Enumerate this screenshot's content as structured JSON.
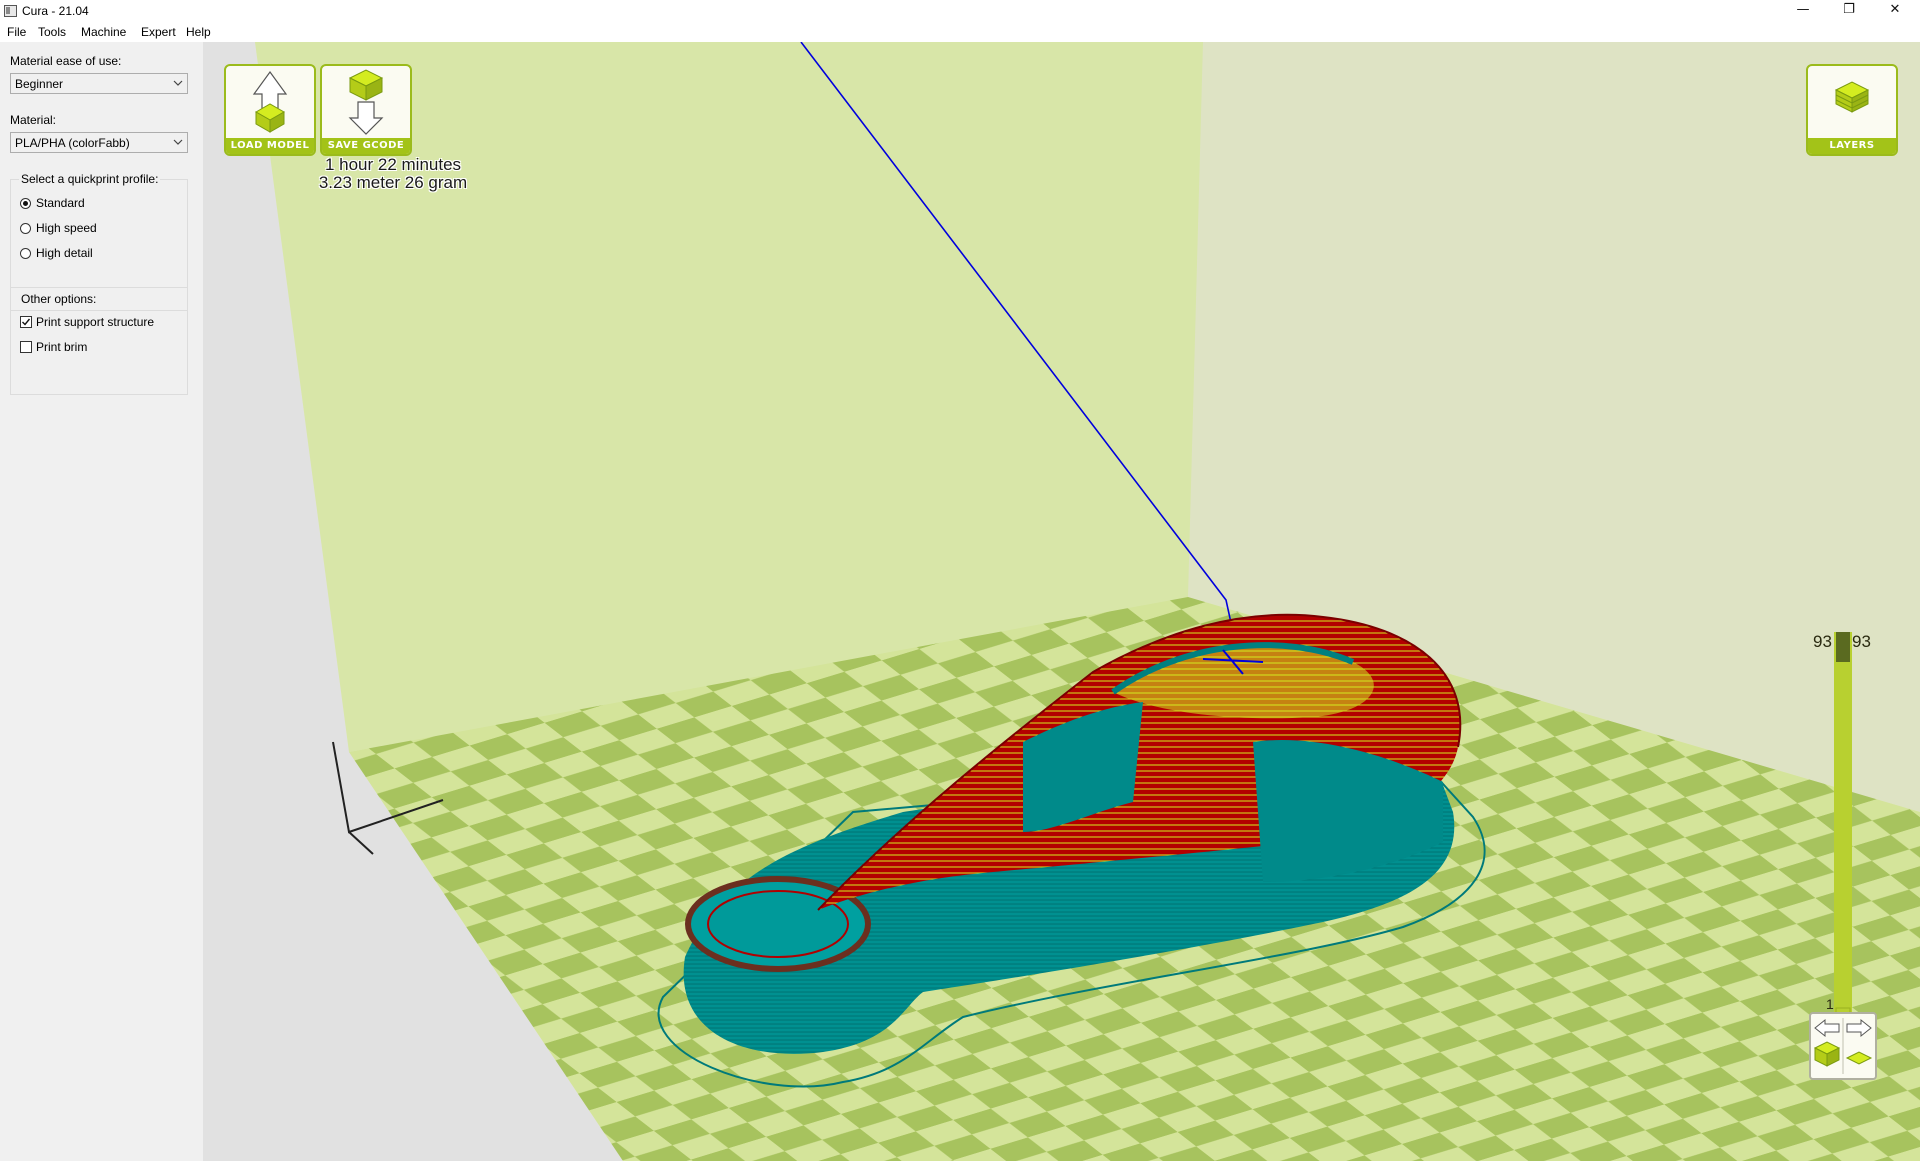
{
  "window": {
    "title": "Cura - 21.04",
    "controls": {
      "minimize": "—",
      "restore": "❐",
      "close": "✕"
    }
  },
  "menu": [
    "File",
    "Tools",
    "Machine",
    "Expert",
    "Help"
  ],
  "settings": {
    "ease_label": "Material ease of use:",
    "ease_value": "Beginner",
    "material_label": "Material:",
    "material_value": "PLA/PHA (colorFabb)",
    "profile_group": {
      "title": "Select a quickprint profile:",
      "options": [
        {
          "label": "Standard",
          "selected": true
        },
        {
          "label": "High speed",
          "selected": false
        },
        {
          "label": "High detail",
          "selected": false
        }
      ]
    },
    "other_group": {
      "title": "Other options:",
      "options": [
        {
          "label": "Print support structure",
          "checked": true
        },
        {
          "label": "Print brim",
          "checked": false
        }
      ]
    }
  },
  "toolbar": {
    "load_model": "LOAD MODEL",
    "save_gcode": "SAVE GCODE",
    "layers": "LAYERS"
  },
  "print_info": {
    "time": "1 hour 22 minutes",
    "material": "3.23 meter 26 gram"
  },
  "layer_slider": {
    "top_left": "93",
    "top_right": "93",
    "bottom": "1"
  },
  "colors": {
    "accent": "#a3c318",
    "plate_light": "#d4e49a",
    "plate_dark": "#a7c35e",
    "wall": "#dfe8b2",
    "support": "#008080",
    "outer_wall": "#a00000",
    "infill": "#d4ec20",
    "travel": "#0000dd"
  }
}
